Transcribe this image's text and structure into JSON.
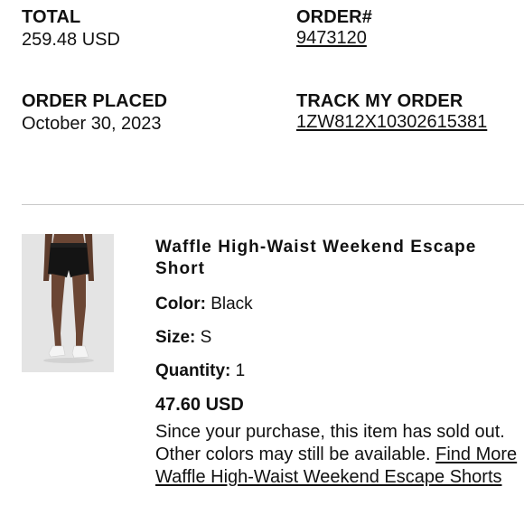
{
  "order_summary": {
    "total": {
      "label": "TOTAL",
      "value": "259.48 USD"
    },
    "order_number": {
      "label": "ORDER#",
      "value": "9473120"
    },
    "order_placed": {
      "label": "ORDER PLACED",
      "value": "October 30, 2023"
    },
    "tracking": {
      "label": "TRACK MY ORDER",
      "value": "1ZW812X10302615381"
    }
  },
  "item": {
    "image_icon": "product-photo-black-shorts",
    "name": "Waffle High-Waist Weekend Escape Short",
    "color": {
      "label": "Color:",
      "value": "Black"
    },
    "size": {
      "label": "Size:",
      "value": "S"
    },
    "quantity": {
      "label": "Quantity:",
      "value": "1"
    },
    "price": "47.60 USD",
    "sold_out_message": "Since your purchase, this item has sold out. Other colors may still be available.",
    "find_more_link": "Find More Waffle High-Waist Weekend Escape Shorts"
  },
  "colors": {
    "text": "#111111",
    "divider": "#c8c8c8",
    "image_background": "#e4e4e4"
  }
}
